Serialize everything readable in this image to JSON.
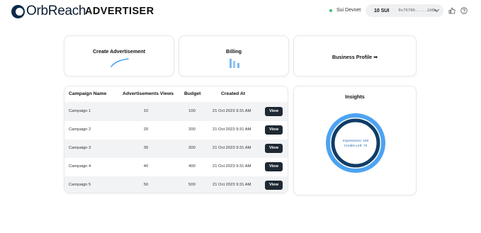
{
  "header": {
    "logo_text": "OrbReach",
    "app_title": "ADVERTISER",
    "network_label": "Sui Devnet",
    "wallet_balance": "10 SUI",
    "wallet_address": "0x76786.....2d8b",
    "icons": [
      "thumbs-up-icon",
      "help-circle-icon"
    ]
  },
  "cards": {
    "create_label": "Create Advertisement",
    "billing_label": "Billing",
    "profile_label": "Business Profile ➡"
  },
  "table": {
    "headers": [
      "Campaign Name",
      "Advertisements Views",
      "Budget",
      "Created At"
    ],
    "rows": [
      {
        "name": "Campaign 1",
        "views": "10",
        "budget": "100",
        "created": "21 Oct 2023 9:31 AM",
        "action": "View"
      },
      {
        "name": "Campaign 2",
        "views": "20",
        "budget": "200",
        "created": "21 Oct 2023 9:31 AM",
        "action": "View"
      },
      {
        "name": "Campaign 3",
        "views": "30",
        "budget": "300",
        "created": "21 Oct 2023 9:31 AM",
        "action": "View"
      },
      {
        "name": "Campaign 4",
        "views": "40",
        "budget": "400",
        "created": "21 Oct 2023 9:31 AM",
        "action": "View"
      },
      {
        "name": "Campaign 5",
        "views": "50",
        "budget": "500",
        "created": "21 Oct 2023 9:31 AM",
        "action": "View"
      }
    ]
  },
  "insights": {
    "title": "Insights",
    "impressions_label": "Impressions: 150",
    "credits_label": "Credits Left: 70"
  },
  "colors": {
    "accent": "#4da3f2",
    "dark_ring": "#0f3d66",
    "button": "#1f2933",
    "status_green": "#38c172"
  }
}
